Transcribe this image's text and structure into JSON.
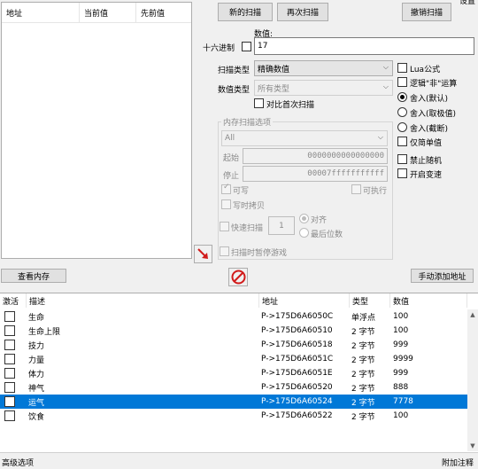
{
  "found_list": {
    "col_address": "地址",
    "col_current": "当前值",
    "col_previous": "先前值"
  },
  "settings_label": "设置",
  "scan_buttons": {
    "new_scan": "新的扫描",
    "next_scan": "再次扫描",
    "undo_scan": "撤销扫描"
  },
  "value": {
    "label": "数值:",
    "hex_label": "十六进制",
    "input": "17"
  },
  "scan_type": {
    "label": "扫描类型",
    "selected": "精确数值"
  },
  "value_type": {
    "label": "数值类型",
    "selected": "所有类型"
  },
  "compare_first": "对比首次扫描",
  "options": {
    "lua": "Lua公式",
    "not_logic": "逻辑\"非\"运算",
    "round_default": "舍入(默认)",
    "round_extreme": "舍入(取极值)",
    "truncate": "舍入(截断)",
    "simple_only": "仅简单值",
    "no_random": "禁止随机",
    "speedhack": "开启变速"
  },
  "mem_options": {
    "title": "内存扫描选项",
    "region": "All",
    "start_label": "起始",
    "start_value": "0000000000000000",
    "stop_label": "停止",
    "stop_value": "00007fffffffffff",
    "writable": "可写",
    "executable": "可执行",
    "copy_on_write": "写时拷贝",
    "fast_scan": "快速扫描",
    "fast_scan_value": "1",
    "align": "对齐",
    "last_digits": "最后位数",
    "pause_game": "扫描时暂停游戏"
  },
  "view_memory": "查看内存",
  "add_address": "手动添加地址",
  "table": {
    "headers": {
      "active": "激活",
      "description": "描述",
      "address": "地址",
      "type": "类型",
      "value": "数值"
    },
    "rows": [
      {
        "description": "生命",
        "address": "P->175D6A6050C",
        "type": "单浮点",
        "value": "100"
      },
      {
        "description": "生命上限",
        "address": "P->175D6A60510",
        "type": "2 字节",
        "value": "100"
      },
      {
        "description": "技力",
        "address": "P->175D6A60518",
        "type": "2 字节",
        "value": "999"
      },
      {
        "description": "力量",
        "address": "P->175D6A6051C",
        "type": "2 字节",
        "value": "9999"
      },
      {
        "description": "体力",
        "address": "P->175D6A6051E",
        "type": "2 字节",
        "value": "999"
      },
      {
        "description": "神气",
        "address": "P->175D6A60520",
        "type": "2 字节",
        "value": "888"
      },
      {
        "description": "运气",
        "address": "P->175D6A60524",
        "type": "2 字节",
        "value": "7778"
      },
      {
        "description": "饮食",
        "address": "P->175D6A60522",
        "type": "2 字节",
        "value": "100"
      }
    ]
  },
  "bottom": {
    "advanced": "高级选项",
    "add_comment": "附加注释"
  },
  "colors": {
    "selection": "#0078d7",
    "stop_icon": "#d11a1a",
    "arrow_icon": "#d11a1a"
  }
}
